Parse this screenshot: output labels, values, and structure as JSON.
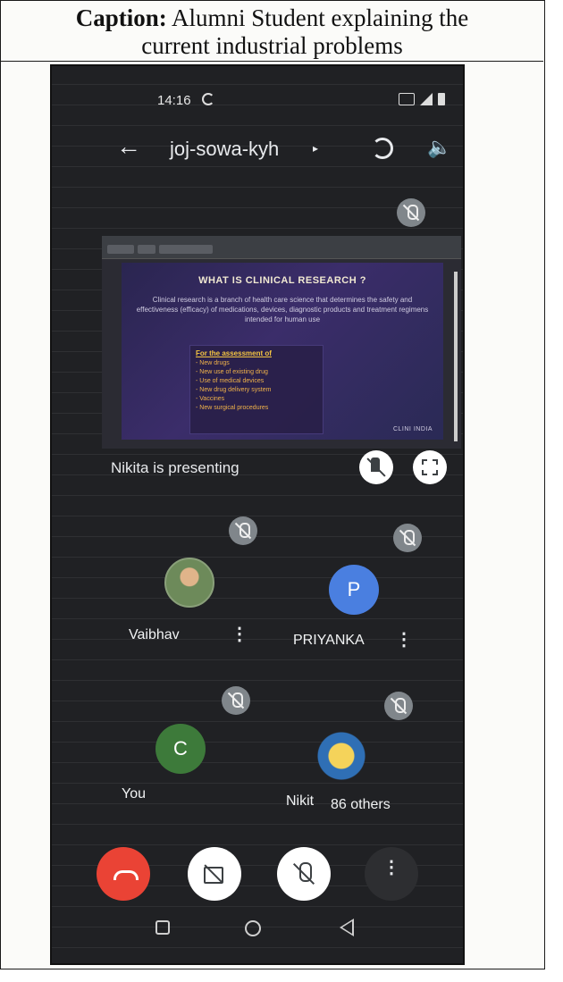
{
  "caption": {
    "label": "Caption:",
    "text_line1": "Alumni Student explaining the",
    "text_line2": "current industrial problems"
  },
  "status_bar": {
    "time": "14:16"
  },
  "meeting": {
    "code": "joj-sowa-kyh",
    "caret": "▸",
    "back_icon": "←",
    "speaker_icon": "🔈"
  },
  "slide": {
    "title": "WHAT IS CLINICAL RESEARCH ?",
    "body": "Clinical research is a branch of health care science that determines the safety and effectiveness (efficacy) of medications, devices, diagnostic products and treatment regimens intended for human use",
    "box_title": "For the assessment of",
    "box_items": [
      "- New drugs",
      "- New use of existing drug",
      "- Use of medical devices",
      "- New drug delivery system",
      "- Vaccines",
      "- New surgical procedures"
    ],
    "logo": "CLINI INDIA"
  },
  "presenting": {
    "text": "Nikita is presenting"
  },
  "participants": [
    {
      "name": "Vaibhav",
      "avatar_letter": "",
      "avatar_color": "#6d8a5a"
    },
    {
      "name": "PRIYANKA",
      "avatar_letter": "P",
      "avatar_color": "#4a7fe0"
    },
    {
      "name": "You",
      "avatar_letter": "C",
      "avatar_color": "#3d7a3a"
    },
    {
      "name": "Nikit",
      "extra": "86 others",
      "avatar_letter": "",
      "avatar_color": "#2f6fb5"
    }
  ],
  "controls": {
    "more": "⋮"
  },
  "colors": {
    "end_call": "#ea4335",
    "background": "#202124"
  }
}
